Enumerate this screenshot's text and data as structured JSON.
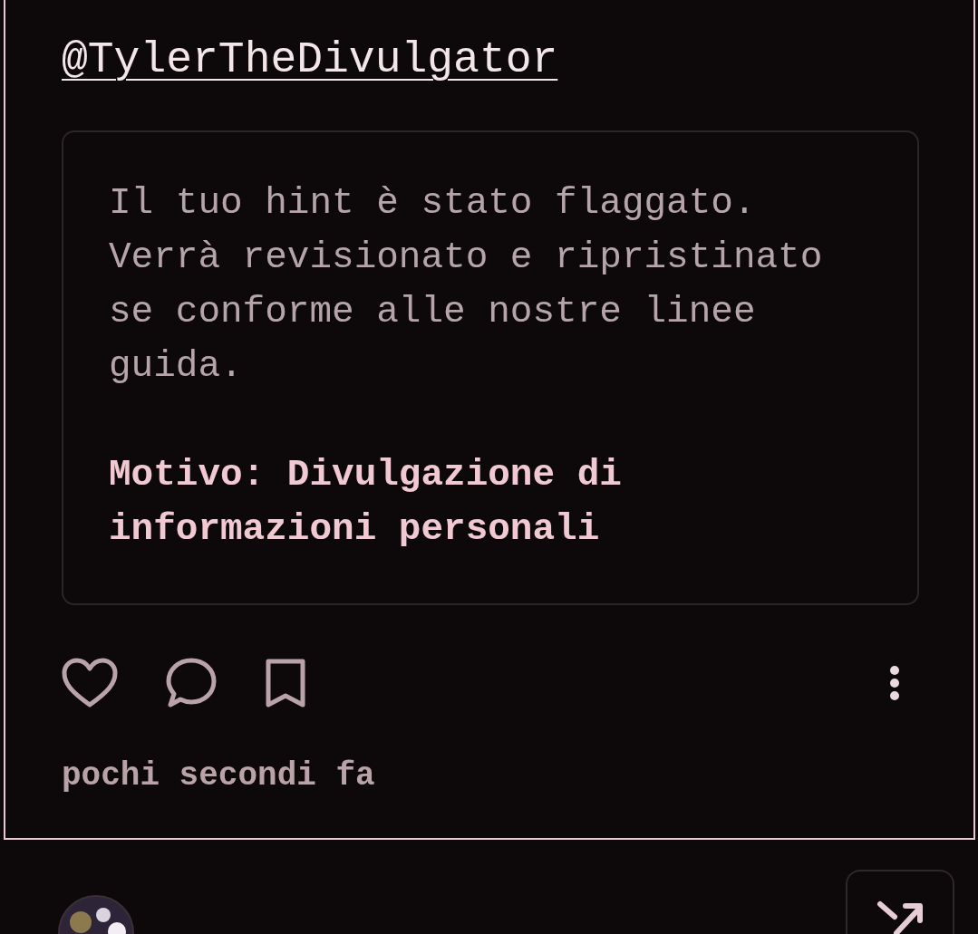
{
  "post": {
    "username": "@TylerTheDivulgator",
    "notice": {
      "message": "Il tuo hint è stato flaggato. Verrà revisionato e ripristinato se conforme alle nostre linee guida.",
      "reason": "Motivo: Divulgazione di informazioni personali"
    },
    "actions": [
      {
        "kind": "like"
      },
      {
        "kind": "comment"
      },
      {
        "kind": "bookmark"
      }
    ],
    "timestamp": "pochi secondi fa"
  }
}
